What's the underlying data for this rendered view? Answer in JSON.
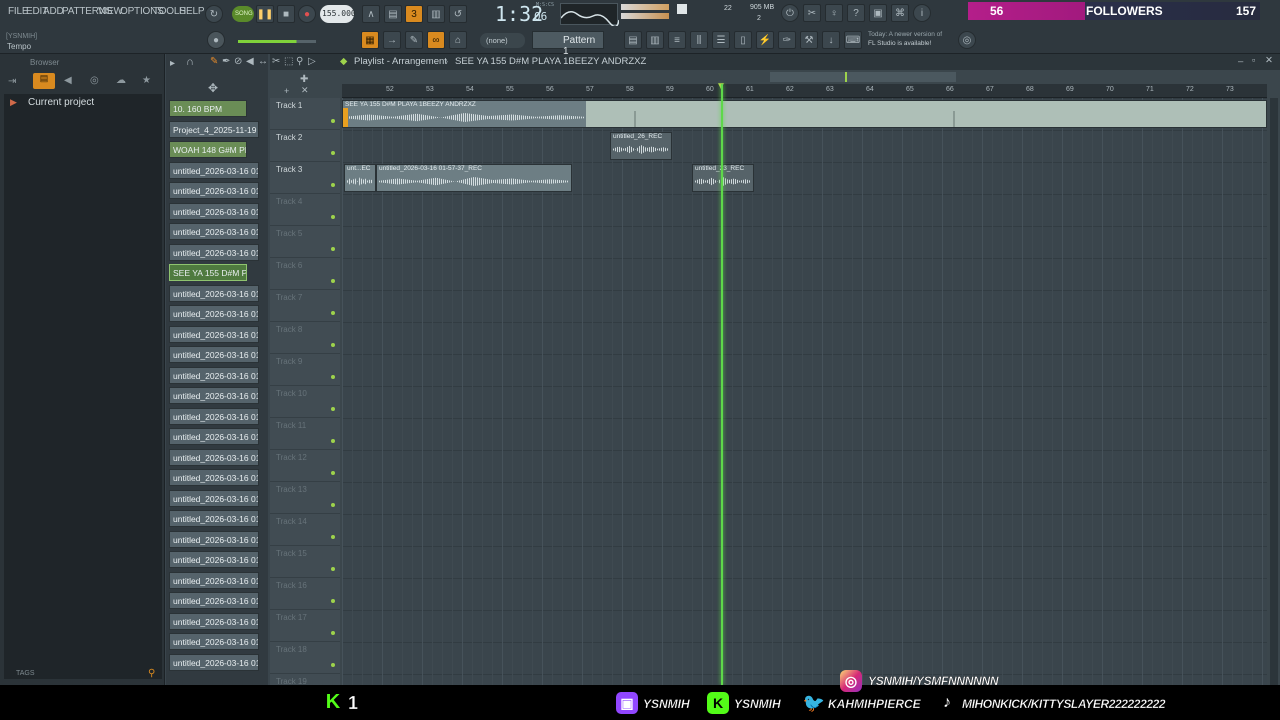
{
  "menu": [
    "FILE",
    "EDIT",
    "ADD",
    "PATTERNS",
    "VIEW",
    "OPTIONS",
    "TOOLS",
    "HELP"
  ],
  "transport": {
    "song_label": "SONG",
    "tempo": "155.000",
    "time": "1:32",
    "time_sub": "06",
    "time_label": "M:S:CS",
    "memory": "905 MB",
    "cpu_a": "22",
    "cpu_b": "2"
  },
  "hint": {
    "user": "[YSNMIH]",
    "field": "Tempo"
  },
  "pattern_selector": {
    "none": "(none)",
    "pattern": "Pattern 1"
  },
  "news": {
    "line1": "Today: A newer version of",
    "line2": "FL Studio is available!"
  },
  "followers": {
    "count_left": "56",
    "label": "FOLLOWERS",
    "count_right": "157"
  },
  "browser": {
    "title": "Browser",
    "tree_item": "Current project",
    "tags": "TAGS"
  },
  "patterns": [
    "10. 160 BPM",
    "Project_4_2025-11-19 1...",
    "WOAH 148 G#M PLAYA...",
    "untitled_2026-03-16 01-...",
    "untitled_2026-03-16 01-...",
    "untitled_2026-03-16 01-...",
    "untitled_2026-03-16 01-...",
    "untitled_2026-03-16 01-...",
    "SEE YA 155 D#M PLAY...",
    "untitled_2026-03-16 01-...",
    "untitled_2026-03-16 01-...",
    "untitled_2026-03-16 01-...",
    "untitled_2026-03-16 01-...",
    "untitled_2026-03-16 01-...",
    "untitled_2026-03-16 01-...",
    "untitled_2026-03-16 01-...",
    "untitled_2026-03-16 01-...",
    "untitled_2026-03-16 01-...",
    "untitled_2026-03-16 01-...",
    "untitled_2026-03-16 01-...",
    "untitled_2026-03-16 01-...",
    "untitled_2026-03-16 01-...",
    "untitled_2026-03-16 01-...",
    "untitled_2026-03-16 01-...",
    "untitled_2026-03-16 01-...",
    "untitled_2026-03-16 01-...",
    "untitled_2026-03-16 01-...",
    "untitled_2026-03-16 01-..."
  ],
  "playlist": {
    "title": "Playlist - Arrangement",
    "crumb": "SEE YA 155 D#M PLAYA 1BEEZY ANDRZXZ",
    "ruler": [
      "52",
      "53",
      "54",
      "55",
      "56",
      "57",
      "58",
      "59",
      "60",
      "61",
      "62",
      "63",
      "64",
      "65",
      "66",
      "67",
      "68",
      "69",
      "70",
      "71",
      "72",
      "73"
    ],
    "tracks": [
      "Track 1",
      "Track 2",
      "Track 3",
      "Track 4",
      "Track 5",
      "Track 6",
      "Track 7",
      "Track 8",
      "Track 9",
      "Track 10",
      "Track 11",
      "Track 12",
      "Track 13",
      "Track 14",
      "Track 15",
      "Track 16",
      "Track 17",
      "Track 18",
      "Track 19"
    ],
    "clips": {
      "main": "SEE YA 155 D#M PLAYA 1BEEZY ANDRZXZ",
      "rec26": "untitled_26_REC",
      "unt": "unt...EC",
      "rec37": "untitled_2026-03-16 01-57-37_REC",
      "rec23": "untitled_23_REC"
    }
  },
  "overlay": {
    "kick_count": "1",
    "instagram": "YSNMIH/YSMFNNNNNN",
    "twitch": "YSNMIH",
    "kick": "YSNMIH",
    "twitter": "KAHMIHPIERCE",
    "tiktok": "MIHONKICK/KITTYSLAYER222222222"
  },
  "colors": {
    "accent": "#d98a1f",
    "followers": "#b41e8a",
    "playhead": "#5ed84a",
    "kick": "#53fc18",
    "twitch": "#9146ff"
  }
}
